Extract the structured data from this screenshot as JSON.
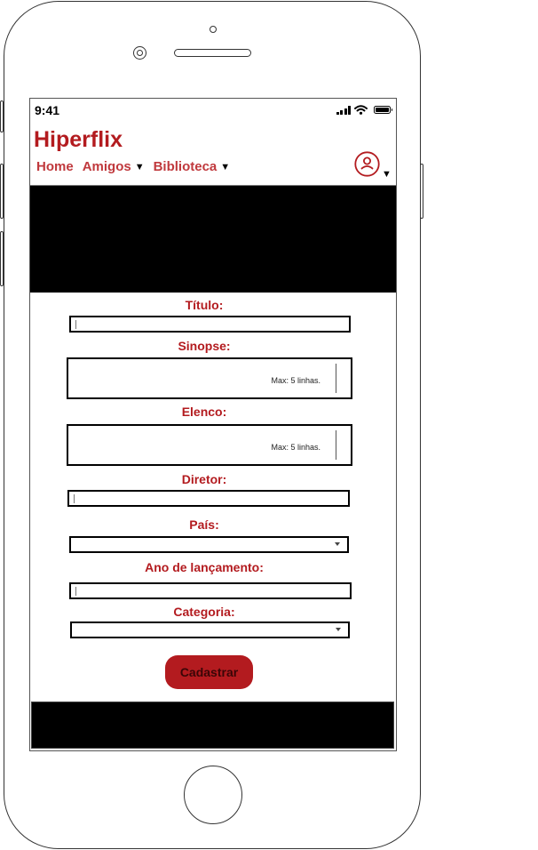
{
  "status": {
    "time": "9:41"
  },
  "app": {
    "title": "Hiperflix"
  },
  "nav": {
    "items": [
      {
        "label": "Home",
        "has_dropdown": false
      },
      {
        "label": "Amigos",
        "has_dropdown": true
      },
      {
        "label": "Biblioteca",
        "has_dropdown": true
      }
    ],
    "dropdown_glyph": "▼"
  },
  "user_menu": {
    "icon": "user-circle-icon",
    "dropdown_glyph": "▼"
  },
  "form": {
    "titulo": {
      "label": "Título:",
      "value": ""
    },
    "sinopse": {
      "label": "Sinopse:",
      "value": "",
      "hint": "Max: 5 linhas."
    },
    "elenco": {
      "label": "Elenco:",
      "value": "",
      "hint": "Max: 5 linhas."
    },
    "diretor": {
      "label": "Diretor:",
      "value": ""
    },
    "pais": {
      "label": "País:",
      "value": ""
    },
    "ano": {
      "label": "Ano de lançamento:",
      "value": ""
    },
    "categoria": {
      "label": "Categoria:",
      "value": ""
    },
    "submit_label": "Cadastrar"
  },
  "colors": {
    "brand": "#b31b1f",
    "nav_text": "#c0393d",
    "banner": "#000000",
    "footer": "#000000"
  }
}
